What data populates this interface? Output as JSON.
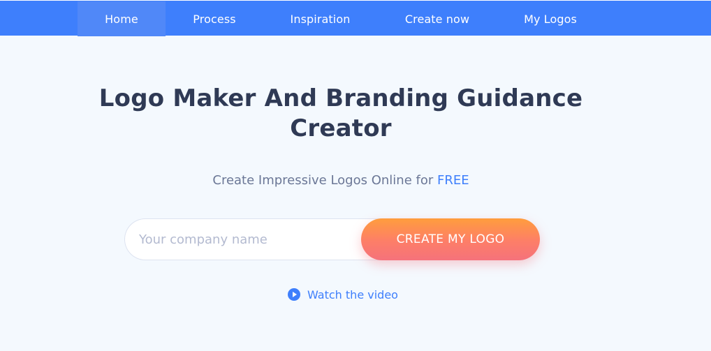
{
  "nav": {
    "items": [
      {
        "label": "Home",
        "active": true
      },
      {
        "label": "Process",
        "active": false
      },
      {
        "label": "Inspiration",
        "active": false
      },
      {
        "label": "Create now",
        "active": false
      },
      {
        "label": "My Logos",
        "active": false
      }
    ]
  },
  "hero": {
    "title": "Logo Maker And Branding Guidance Creator",
    "subtitle_prefix": "Create Impressive Logos Online for",
    "subtitle_highlight": "FREE"
  },
  "form": {
    "company_placeholder": "Your company name",
    "company_value": "",
    "submit_label": "CREATE MY LOGO"
  },
  "video_link": {
    "icon": "play-circle-icon",
    "label": "Watch the video"
  },
  "colors": {
    "brand_blue": "#3e7ffc",
    "active_nav": "#5088f8",
    "title_text": "#2f3a55",
    "button_gradient_top": "#ff9d3d",
    "button_gradient_bottom": "#f5727b",
    "background": "#f4f9fe"
  }
}
